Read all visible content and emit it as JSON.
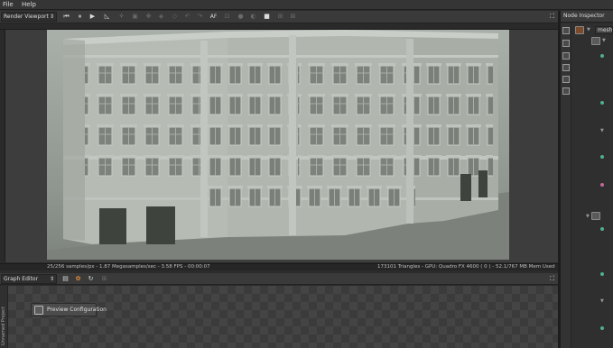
{
  "menu": {
    "items": [
      "File",
      "Help"
    ]
  },
  "viewport": {
    "mode_label": "Render Viewport",
    "fullscreen_icon": "expand-icon",
    "status_left": "25/256 samples/px - 1.87 Megasamples/sec - 3.58 FPS - 00:00:07",
    "status_right": "173101 Triangles - GPU: Quadro FX 4600 ( 0 ) - 52.1/767 MB Mem Used"
  },
  "graph_editor": {
    "title": "Graph Editor",
    "side_label": "Unnamed Project",
    "node_label": "Preview Configuration"
  },
  "inspector": {
    "title": "Node Inspector",
    "mesh_label": "mesh"
  }
}
